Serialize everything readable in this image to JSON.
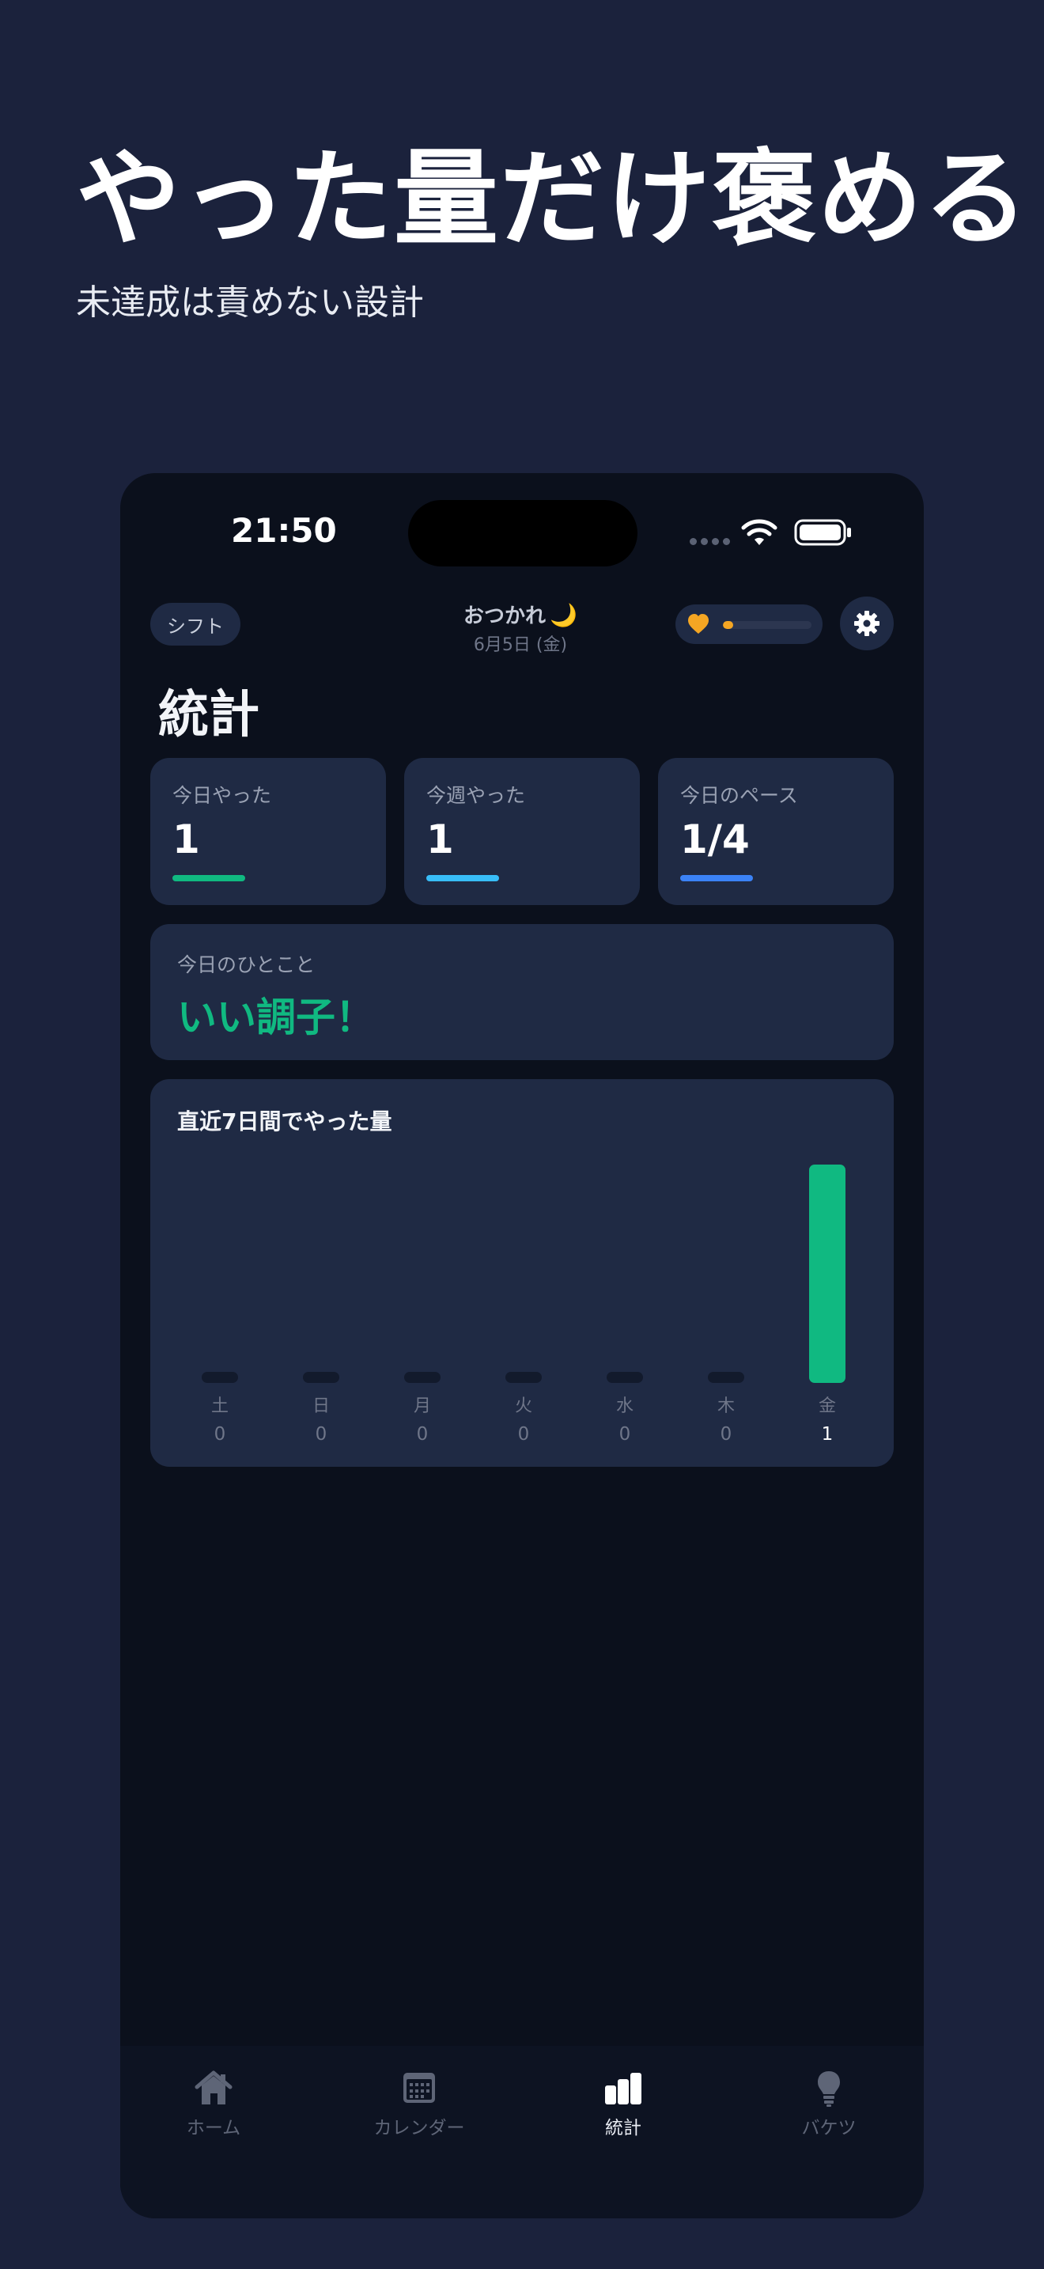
{
  "hero": {
    "headline": "やった量だけ褒める",
    "subline": "未達成は責めない設計"
  },
  "status_bar": {
    "time": "21:50"
  },
  "topbar": {
    "shift_label": "シフト",
    "greeting": "おつかれ",
    "greeting_emoji": "🌙",
    "date": "6月5日 (金)",
    "energy_level": 0.12,
    "accent_heart_color": "#f5a623"
  },
  "page": {
    "title": "統計"
  },
  "stats": [
    {
      "label": "今日やった",
      "value": "1",
      "accent": "#10b981"
    },
    {
      "label": "今週やった",
      "value": "1",
      "accent": "#38bdf8"
    },
    {
      "label": "今日のペース",
      "value": "1/4",
      "accent": "#3b82f6"
    }
  ],
  "phrase": {
    "label": "今日のひとこと",
    "text": "いい調子！",
    "color": "#10b981"
  },
  "chart_data": {
    "type": "bar",
    "title": "直近7日間でやった量",
    "categories": [
      "土",
      "日",
      "月",
      "火",
      "水",
      "木",
      "金"
    ],
    "values": [
      0,
      0,
      0,
      0,
      0,
      0,
      1
    ],
    "ylim": [
      0,
      1
    ],
    "bar_color": "#10b981",
    "empty_bar_color": "#121a2c",
    "grid": false
  },
  "tabs": [
    {
      "label": "ホーム",
      "icon": "home-icon",
      "active": false
    },
    {
      "label": "カレンダー",
      "icon": "calendar-icon",
      "active": false
    },
    {
      "label": "統計",
      "icon": "stats-icon",
      "active": true
    },
    {
      "label": "バケツ",
      "icon": "bulb-icon",
      "active": false
    }
  ]
}
